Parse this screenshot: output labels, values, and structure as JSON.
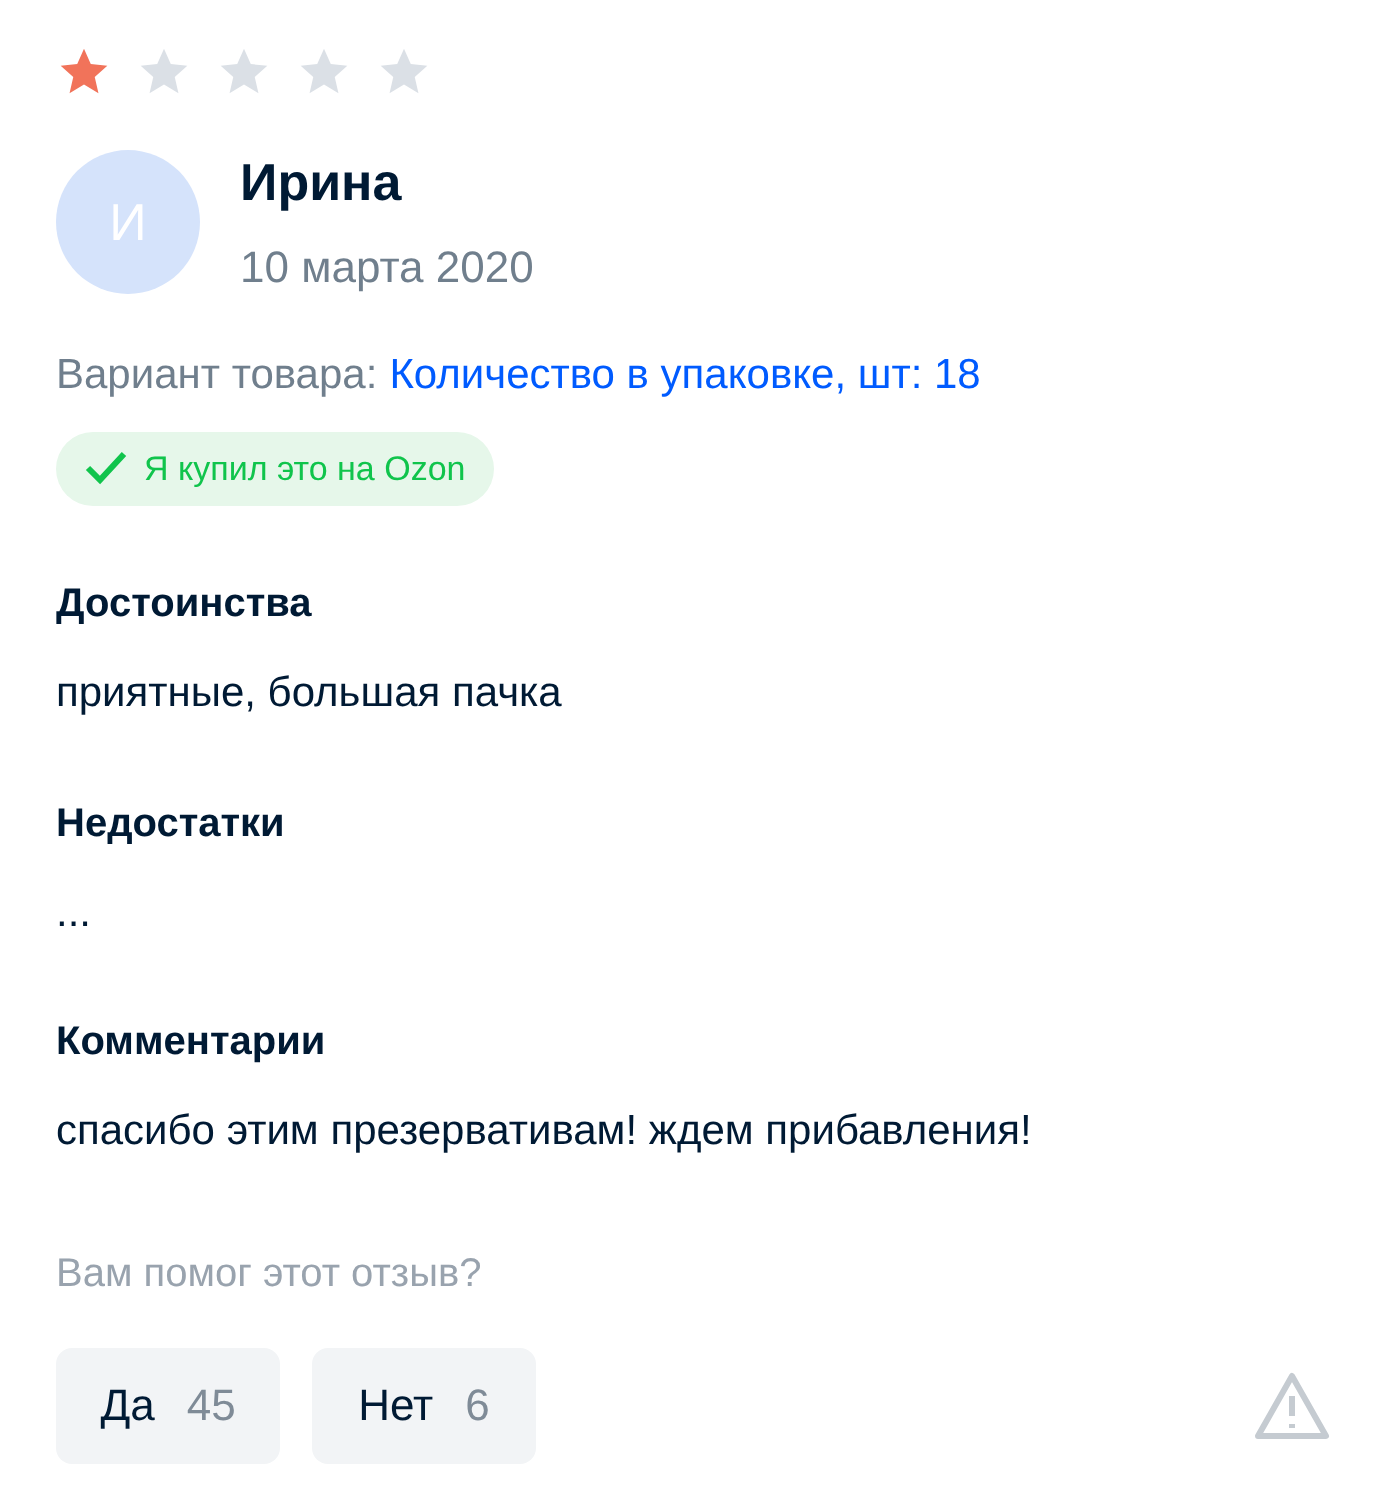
{
  "review": {
    "stars": 1,
    "author": {
      "initial": "И",
      "name": "Ирина",
      "date": "10 марта 2020"
    },
    "variant": {
      "label": "Вариант товара:",
      "value": "Количество в упаковке, шт: 18"
    },
    "verified_badge": "Я купил это на Ozon",
    "sections": [
      {
        "title": "Достоинства",
        "text": "приятные, большая пачка"
      },
      {
        "title": "Недостатки",
        "text": "..."
      },
      {
        "title": "Комментарии",
        "text": "спасибо этим презервативам! ждем прибавления!"
      }
    ],
    "helpful": {
      "question": "Вам помог этот отзыв?",
      "buttons": [
        {
          "label": "Да",
          "count": "45"
        },
        {
          "label": "Нет",
          "count": "6"
        }
      ]
    }
  }
}
